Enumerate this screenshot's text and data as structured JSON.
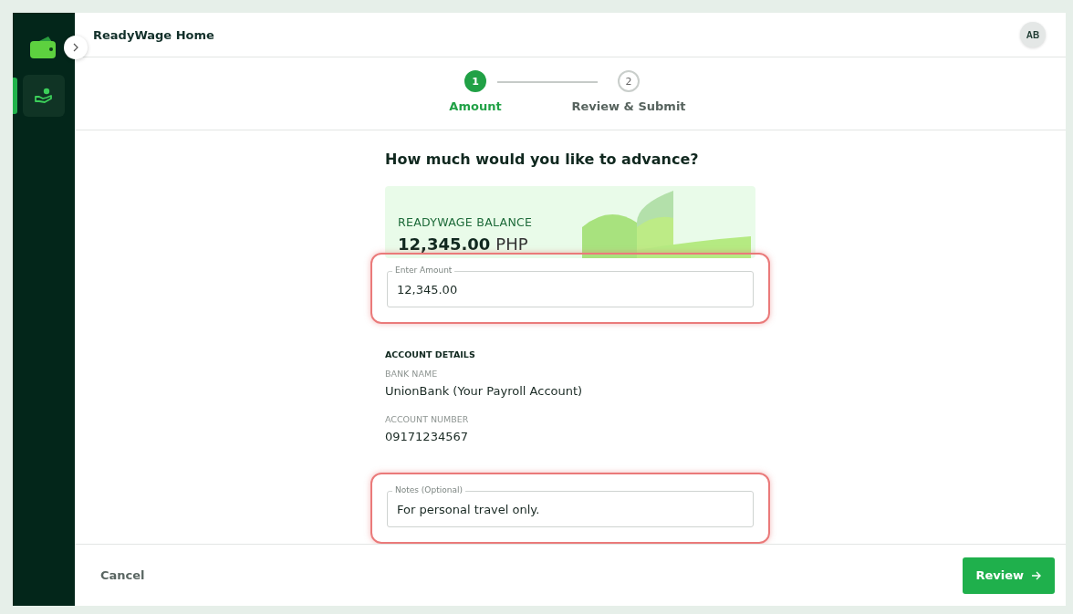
{
  "sidebar": {
    "items": [
      {
        "kind": "hand-coin",
        "selected": true
      }
    ]
  },
  "header": {
    "title": "ReadyWage Home",
    "avatar": "AB"
  },
  "steps": [
    {
      "number": "1",
      "label": "Amount",
      "selected": true
    },
    {
      "number": "2",
      "label": "Review & Submit",
      "selected": false
    }
  ],
  "form": {
    "heading": "How much would you like to advance?",
    "balance": {
      "label": "READYWAGE BALANCE",
      "amount": "12,345.00",
      "currency": "PHP"
    },
    "amount_field": {
      "label": "Enter Amount",
      "value": "12,345.00",
      "highlighted": true
    },
    "account": {
      "heading": "ACCOUNT DETAILS",
      "fields": [
        {
          "label": "BANK NAME",
          "value": "UnionBank (Your Payroll Account)"
        },
        {
          "label": "ACCOUNT NUMBER",
          "value": "09171234567"
        }
      ]
    },
    "notes_field": {
      "label": "Notes (Optional)",
      "value": "For personal travel only.",
      "highlighted": true
    }
  },
  "footer": {
    "cancel": "Cancel",
    "review": "Review"
  }
}
